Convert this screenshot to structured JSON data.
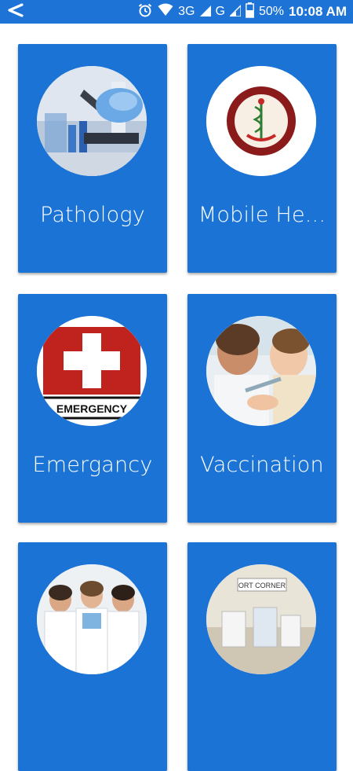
{
  "status_bar": {
    "network_3g": "3G",
    "network_g": "G",
    "battery": "50%",
    "time": "10:08 AM",
    "color": "#1e73d6"
  },
  "cards": [
    {
      "label": "Pathology",
      "icon": "microscope-lab-image"
    },
    {
      "label": "Mobile He...",
      "icon": "hospital-logo-image",
      "logo_text": "Colonel Malek Medical College Hospital",
      "logo_sub": "MANIKGONJ"
    },
    {
      "label": "Emergancy",
      "icon": "emergency-cross-image",
      "sign_text": "EMERGENCY"
    },
    {
      "label": "Vaccination",
      "icon": "vaccination-image"
    },
    {
      "label": "",
      "icon": "doctors-group-image"
    },
    {
      "label": "",
      "icon": "ort-corner-image",
      "sign_text": "ORT CORNER"
    }
  ],
  "card_color": "#1b74d5"
}
